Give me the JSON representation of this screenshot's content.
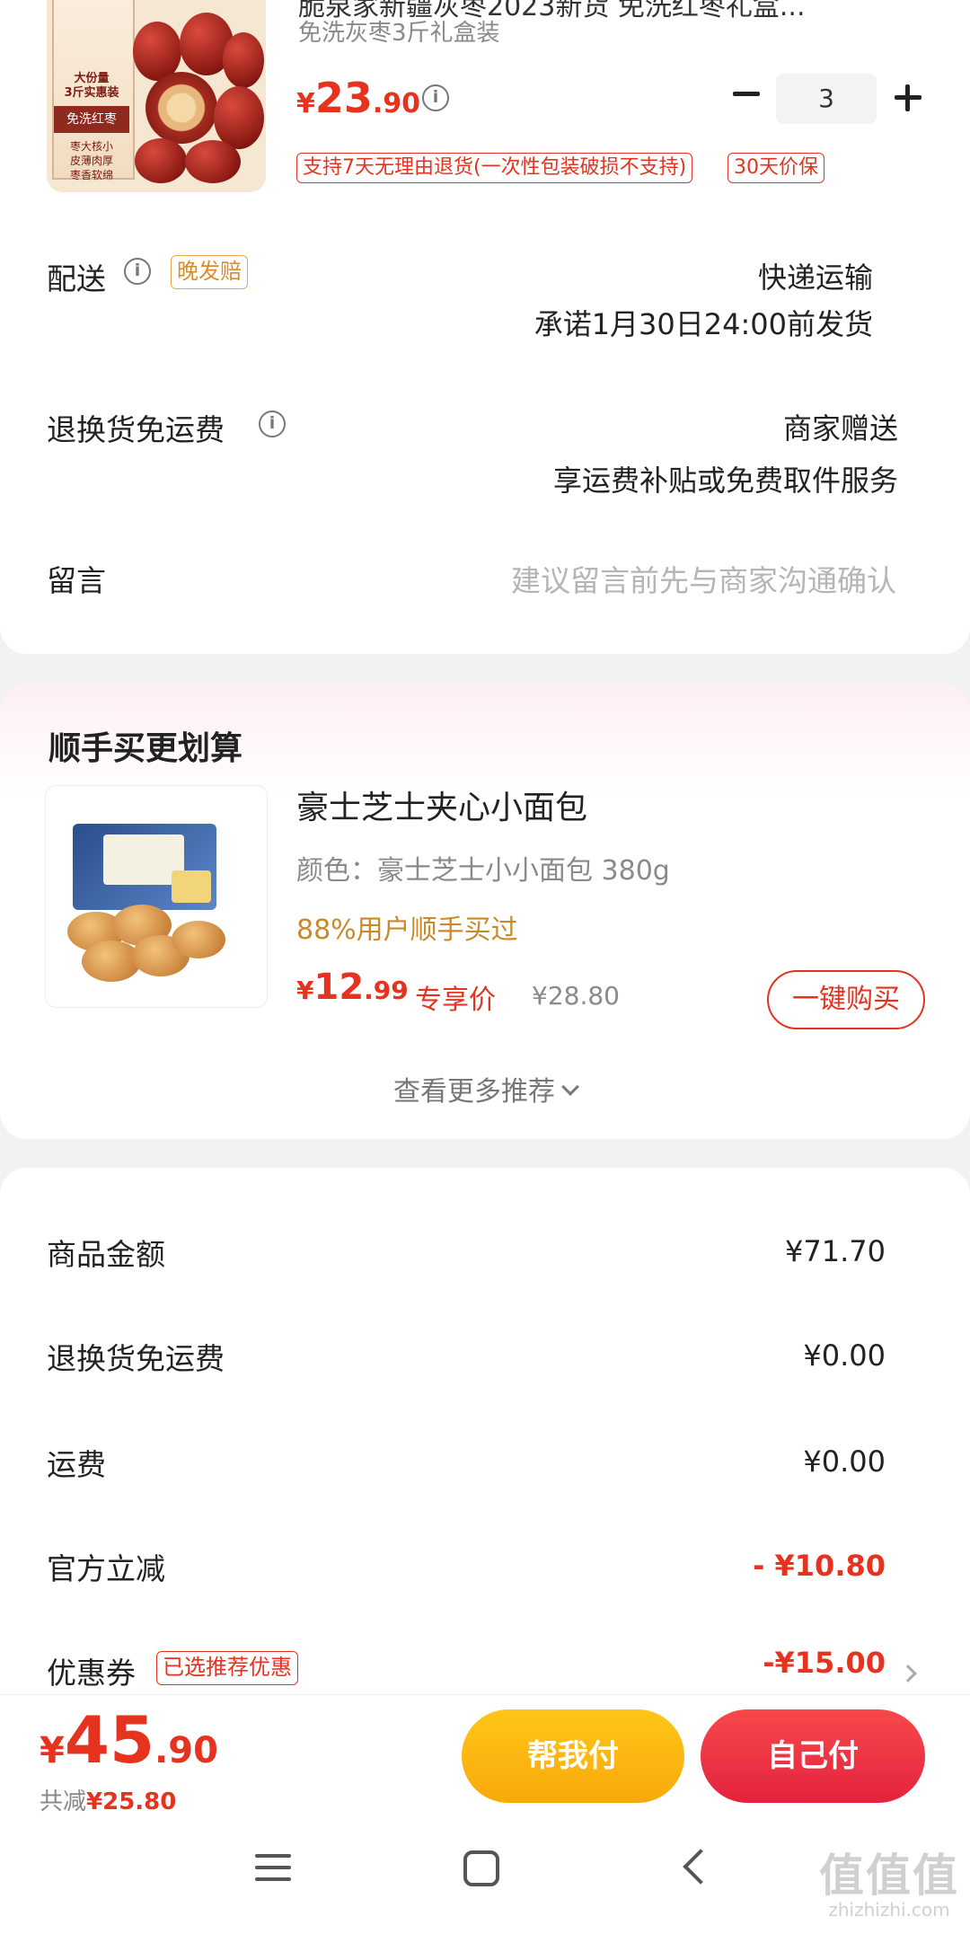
{
  "product": {
    "title": "脆泉家新疆灰枣2023新货 免洗红枣礼盒...",
    "spec": "免洗灰枣3斤礼盒装",
    "image_texts": [
      "大份量",
      "3斤实惠装",
      "免洗红枣",
      "枣大核小",
      "皮薄肉厚",
      "枣香软绵"
    ],
    "price": {
      "currency": "¥",
      "integer": "23",
      "decimal": ".90"
    },
    "quantity": "3",
    "tags": [
      "支持7天无理由退货(一次性包装破损不支持)",
      "30天价保"
    ]
  },
  "delivery": {
    "label": "配送",
    "badge": "晚发赔",
    "method": "快递运输",
    "promise": "承诺1月30日24:00前发货"
  },
  "return_shipping": {
    "label": "退换货免运费",
    "value": "商家赠送",
    "desc": "享运费补贴或免费取件服务"
  },
  "note": {
    "label": "留言",
    "placeholder": "建议留言前先与商家沟通确认"
  },
  "recommend": {
    "section_title": "顺手买更划算",
    "name": "豪士芝士夹心小面包",
    "spec": "颜色：豪士芝士小小面包 380g",
    "social": "88%用户顺手买过",
    "price": {
      "currency": "¥",
      "integer": "12",
      "decimal": ".99"
    },
    "exclusive_label": "专享价",
    "original_price": "¥28.80",
    "buy_button": "一键购买",
    "see_more": "查看更多推荐"
  },
  "summary": {
    "rows": [
      {
        "label": "商品金额",
        "value": "¥71.70"
      },
      {
        "label": "退换货免运费",
        "value": "¥0.00"
      },
      {
        "label": "运费",
        "value": "¥0.00"
      },
      {
        "label": "官方立减",
        "value": "- ¥10.80"
      },
      {
        "label": "优惠券",
        "value": "-¥15.00",
        "tag": "已选推荐优惠"
      }
    ]
  },
  "checkout": {
    "total": {
      "currency": "¥",
      "integer": "45",
      "decimal": ".90"
    },
    "saved_label": "共减",
    "saved_value": "¥25.80",
    "help_pay": "帮我付",
    "self_pay": "自己付"
  },
  "watermark": {
    "logo": "值值值",
    "url": "zhizhizhi.com"
  },
  "colors": {
    "accent": "#e6331f",
    "gold": "#f8a90a",
    "gold_text": "#c98a2c"
  }
}
